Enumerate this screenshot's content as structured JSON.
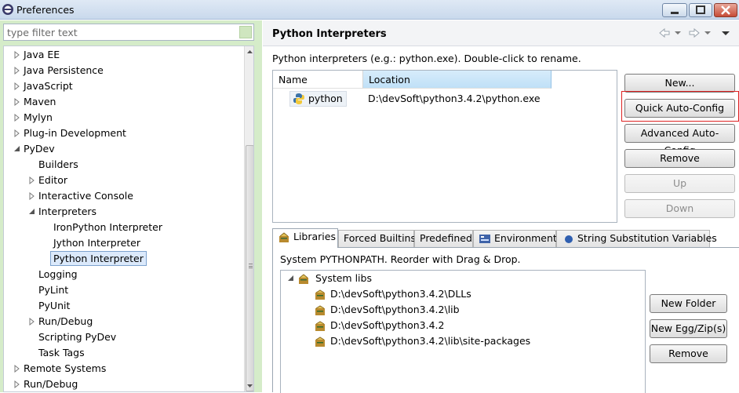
{
  "window": {
    "title": "Preferences"
  },
  "left": {
    "filter_placeholder": "type filter text",
    "tree": [
      {
        "label": "Java EE",
        "level": 0,
        "state": "collapsed"
      },
      {
        "label": "Java Persistence",
        "level": 0,
        "state": "collapsed"
      },
      {
        "label": "JavaScript",
        "level": 0,
        "state": "collapsed"
      },
      {
        "label": "Maven",
        "level": 0,
        "state": "collapsed"
      },
      {
        "label": "Mylyn",
        "level": 0,
        "state": "collapsed"
      },
      {
        "label": "Plug-in Development",
        "level": 0,
        "state": "collapsed"
      },
      {
        "label": "PyDev",
        "level": 0,
        "state": "expanded"
      },
      {
        "label": "Builders",
        "level": 1,
        "state": "leaf"
      },
      {
        "label": "Editor",
        "level": 1,
        "state": "collapsed"
      },
      {
        "label": "Interactive Console",
        "level": 1,
        "state": "collapsed"
      },
      {
        "label": "Interpreters",
        "level": 1,
        "state": "expanded"
      },
      {
        "label": "IronPython Interpreter",
        "level": 2,
        "state": "leaf"
      },
      {
        "label": "Jython Interpreter",
        "level": 2,
        "state": "leaf"
      },
      {
        "label": "Python Interpreter",
        "level": 2,
        "state": "leaf",
        "selected": true
      },
      {
        "label": "Logging",
        "level": 1,
        "state": "leaf"
      },
      {
        "label": "PyLint",
        "level": 1,
        "state": "leaf"
      },
      {
        "label": "PyUnit",
        "level": 1,
        "state": "leaf"
      },
      {
        "label": "Run/Debug",
        "level": 1,
        "state": "collapsed"
      },
      {
        "label": "Scripting PyDev",
        "level": 1,
        "state": "leaf"
      },
      {
        "label": "Task Tags",
        "level": 1,
        "state": "leaf"
      },
      {
        "label": "Remote Systems",
        "level": 0,
        "state": "collapsed"
      },
      {
        "label": "Run/Debug",
        "level": 0,
        "state": "collapsed"
      }
    ]
  },
  "right": {
    "title": "Python Interpreters",
    "description": "Python interpreters (e.g.: python.exe).   Double-click to rename.",
    "table": {
      "columns": [
        "Name",
        "Location"
      ],
      "rows": [
        {
          "name": "python",
          "location": "D:\\devSoft\\python3.4.2\\python.exe"
        }
      ]
    },
    "buttons": {
      "new": "New...",
      "quick_auto": "Quick Auto-Config",
      "advanced_auto": "Advanced Auto-Config",
      "remove": "Remove",
      "up": "Up",
      "down": "Down"
    },
    "tabs": [
      {
        "label": "Libraries",
        "icon": "libraries-icon",
        "active": true
      },
      {
        "label": "Forced Builtins"
      },
      {
        "label": "Predefined"
      },
      {
        "label": "Environment",
        "icon": "environment-icon"
      },
      {
        "label": "String Substitution Variables",
        "icon": "variables-icon"
      }
    ],
    "libraries": {
      "description": "System PYTHONPATH.   Reorder with Drag & Drop.",
      "root": "System libs",
      "paths": [
        "D:\\devSoft\\python3.4.2\\DLLs",
        "D:\\devSoft\\python3.4.2\\lib",
        "D:\\devSoft\\python3.4.2",
        "D:\\devSoft\\python3.4.2\\lib\\site-packages"
      ],
      "buttons": {
        "new_folder": "New Folder",
        "new_egg": "New Egg/Zip(s)",
        "remove": "Remove"
      }
    }
  },
  "colors": {
    "left_background": "#d5ecc9",
    "highlight_frame": "#dd2222",
    "selection": "#dbe9fb"
  }
}
